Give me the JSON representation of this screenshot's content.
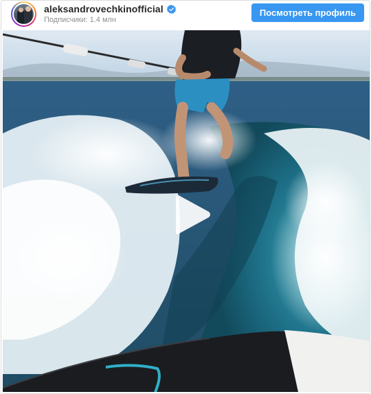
{
  "header": {
    "username": "aleksandrovechkinofficial",
    "followers_text": "Подписчики: 1.4 млн",
    "profile_button_label": "Посмотреть профиль"
  },
  "icons": {
    "verified": "verified-badge-icon",
    "play": "play-icon"
  },
  "colors": {
    "accent": "#3897f0",
    "verified": "#3897f0",
    "border": "#dbdbdb"
  },
  "media": {
    "type": "video"
  }
}
